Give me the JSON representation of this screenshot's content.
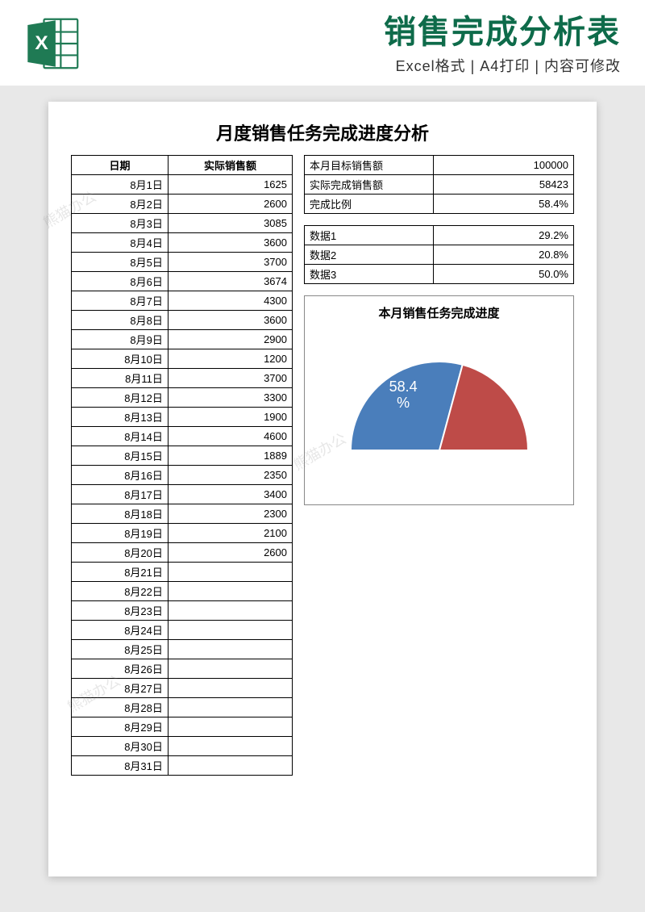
{
  "header": {
    "title": "销售完成分析表",
    "subtitle": "Excel格式 | A4打印 | 内容可修改"
  },
  "doc_title": "月度销售任务完成进度分析",
  "left_headers": [
    "日期",
    "实际销售额"
  ],
  "rows": [
    {
      "date": "8月1日",
      "val": "1625"
    },
    {
      "date": "8月2日",
      "val": "2600"
    },
    {
      "date": "8月3日",
      "val": "3085"
    },
    {
      "date": "8月4日",
      "val": "3600"
    },
    {
      "date": "8月5日",
      "val": "3700"
    },
    {
      "date": "8月6日",
      "val": "3674"
    },
    {
      "date": "8月7日",
      "val": "4300"
    },
    {
      "date": "8月8日",
      "val": "3600"
    },
    {
      "date": "8月9日",
      "val": "2900"
    },
    {
      "date": "8月10日",
      "val": "1200"
    },
    {
      "date": "8月11日",
      "val": "3700"
    },
    {
      "date": "8月12日",
      "val": "3300"
    },
    {
      "date": "8月13日",
      "val": "1900"
    },
    {
      "date": "8月14日",
      "val": "4600"
    },
    {
      "date": "8月15日",
      "val": "1889"
    },
    {
      "date": "8月16日",
      "val": "2350"
    },
    {
      "date": "8月17日",
      "val": "3400"
    },
    {
      "date": "8月18日",
      "val": "2300"
    },
    {
      "date": "8月19日",
      "val": "2100"
    },
    {
      "date": "8月20日",
      "val": "2600"
    },
    {
      "date": "8月21日",
      "val": ""
    },
    {
      "date": "8月22日",
      "val": ""
    },
    {
      "date": "8月23日",
      "val": ""
    },
    {
      "date": "8月24日",
      "val": ""
    },
    {
      "date": "8月25日",
      "val": ""
    },
    {
      "date": "8月26日",
      "val": ""
    },
    {
      "date": "8月27日",
      "val": ""
    },
    {
      "date": "8月28日",
      "val": ""
    },
    {
      "date": "8月29日",
      "val": ""
    },
    {
      "date": "8月30日",
      "val": ""
    },
    {
      "date": "8月31日",
      "val": ""
    }
  ],
  "summary": [
    {
      "label": "本月目标销售额",
      "value": "100000"
    },
    {
      "label": "实际完成销售额",
      "value": "58423"
    },
    {
      "label": "完成比例",
      "value": "58.4%"
    }
  ],
  "data_rows": [
    {
      "label": "数据1",
      "value": "29.2%"
    },
    {
      "label": "数据2",
      "value": "20.8%"
    },
    {
      "label": "数据3",
      "value": "50.0%"
    }
  ],
  "chart_data": {
    "type": "pie",
    "title": "本月销售任务完成进度",
    "display_label": "58.4\n%",
    "series": [
      {
        "name": "数据1",
        "value": 29.2,
        "color": "#4a7ebb"
      },
      {
        "name": "数据2",
        "value": 20.8,
        "color": "#be4b48"
      },
      {
        "name": "数据3",
        "value": 50.0,
        "color": "#ffffff"
      }
    ],
    "note": "Rendered as half-donut gauge; 数据3 (50%) is the hidden lower half. Visible completion ≈ 58.4% of the top half arc (29.2/(29.2+20.8))."
  },
  "watermark_text": "熊猫办公"
}
